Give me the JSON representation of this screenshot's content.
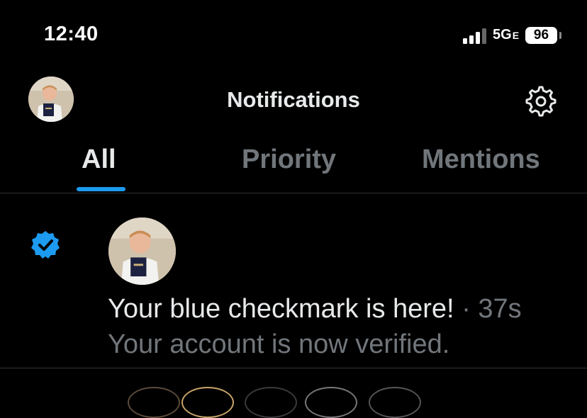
{
  "status_bar": {
    "time": "12:40",
    "network": "5G",
    "network_suffix": "E",
    "battery": "96"
  },
  "header": {
    "title": "Notifications",
    "avatar_icon": "profile-avatar",
    "settings_icon": "gear-icon"
  },
  "tabs": [
    {
      "label": "All",
      "active": true
    },
    {
      "label": "Priority",
      "active": false
    },
    {
      "label": "Mentions",
      "active": false
    }
  ],
  "notification": {
    "icon": "verified-badge-icon",
    "title": "Your blue checkmark is here!",
    "time": "· 37s",
    "subtitle": "Your account is now verified."
  },
  "colors": {
    "background": "#000000",
    "accent": "#1d9bf0",
    "text_primary": "#e7e9ea",
    "text_secondary": "#71767b",
    "divider": "#2f3336"
  }
}
